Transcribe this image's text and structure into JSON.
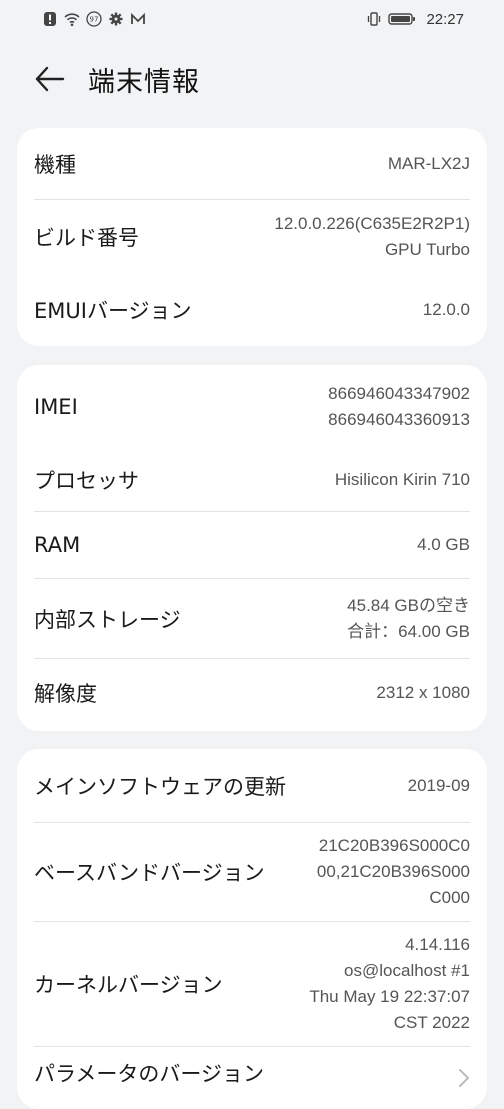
{
  "status_bar": {
    "time": "22:27",
    "icons": [
      "alert-icon",
      "wifi-icon",
      "badge-97-icon",
      "gear-icon",
      "mail-icon",
      "vibrate-icon",
      "battery-icon"
    ],
    "badge_text": "97"
  },
  "header": {
    "title": "端末情報"
  },
  "card1": {
    "rows": [
      {
        "label": "機種",
        "value": [
          "MAR-LX2J"
        ]
      },
      {
        "label": "ビルド番号",
        "value": [
          "12.0.0.226(C635E2R2P1)",
          "GPU Turbo"
        ]
      },
      {
        "label": "EMUIバージョン",
        "value": [
          "12.0.0"
        ]
      }
    ]
  },
  "card2": {
    "rows": [
      {
        "label": "IMEI",
        "value": [
          "866946043347902",
          "866946043360913"
        ]
      },
      {
        "label": "プロセッサ",
        "value": [
          "Hisilicon Kirin 710"
        ]
      },
      {
        "label": "RAM",
        "value": [
          "4.0 GB"
        ]
      },
      {
        "label": "内部ストレージ",
        "value": [
          "45.84  GBの空き",
          "合計：64.00  GB"
        ]
      },
      {
        "label": "解像度",
        "value": [
          "2312 x 1080"
        ]
      }
    ]
  },
  "card3": {
    "rows": [
      {
        "label": "メインソフトウェアの更新",
        "value": [
          "2019-09"
        ]
      },
      {
        "label": "ベースバンドバージョン",
        "value": [
          "21C20B396S000C0",
          "00,21C20B396S000",
          "C000"
        ]
      },
      {
        "label": "カーネルバージョン",
        "value": [
          "4.14.116",
          "os@localhost #1",
          "Thu May 19 22:37:07",
          "CST 2022"
        ]
      },
      {
        "label": "パラメータのバージョン",
        "value": []
      }
    ]
  }
}
